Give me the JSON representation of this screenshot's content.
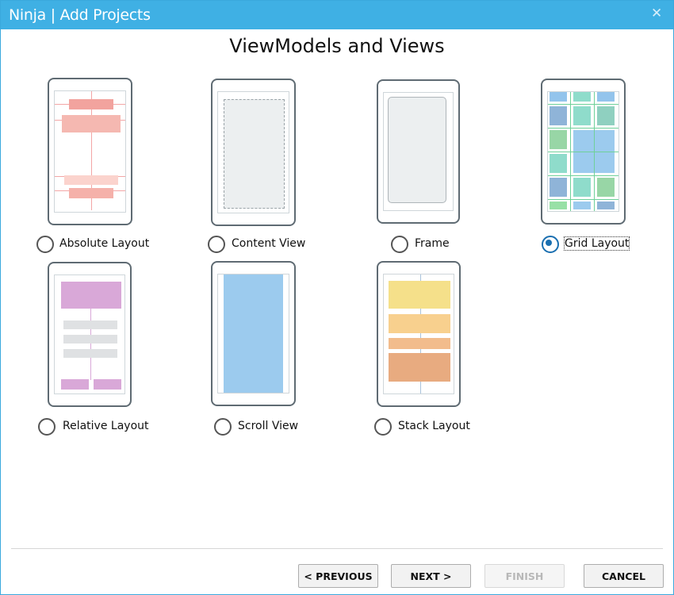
{
  "window": {
    "title": "Ninja | Add Projects",
    "close_glyph": "✕"
  },
  "heading": "ViewModels and Views",
  "options": [
    {
      "label": "Absolute Layout",
      "selected": false
    },
    {
      "label": "Content View",
      "selected": false
    },
    {
      "label": "Frame",
      "selected": false
    },
    {
      "label": "Grid Layout",
      "selected": true
    },
    {
      "label": "Relative Layout",
      "selected": false
    },
    {
      "label": "Scroll View",
      "selected": false
    },
    {
      "label": "Stack Layout",
      "selected": false
    }
  ],
  "buttons": {
    "previous": "< PREVIOUS",
    "next": "NEXT >",
    "finish": "FINISH",
    "cancel": "CANCEL"
  }
}
